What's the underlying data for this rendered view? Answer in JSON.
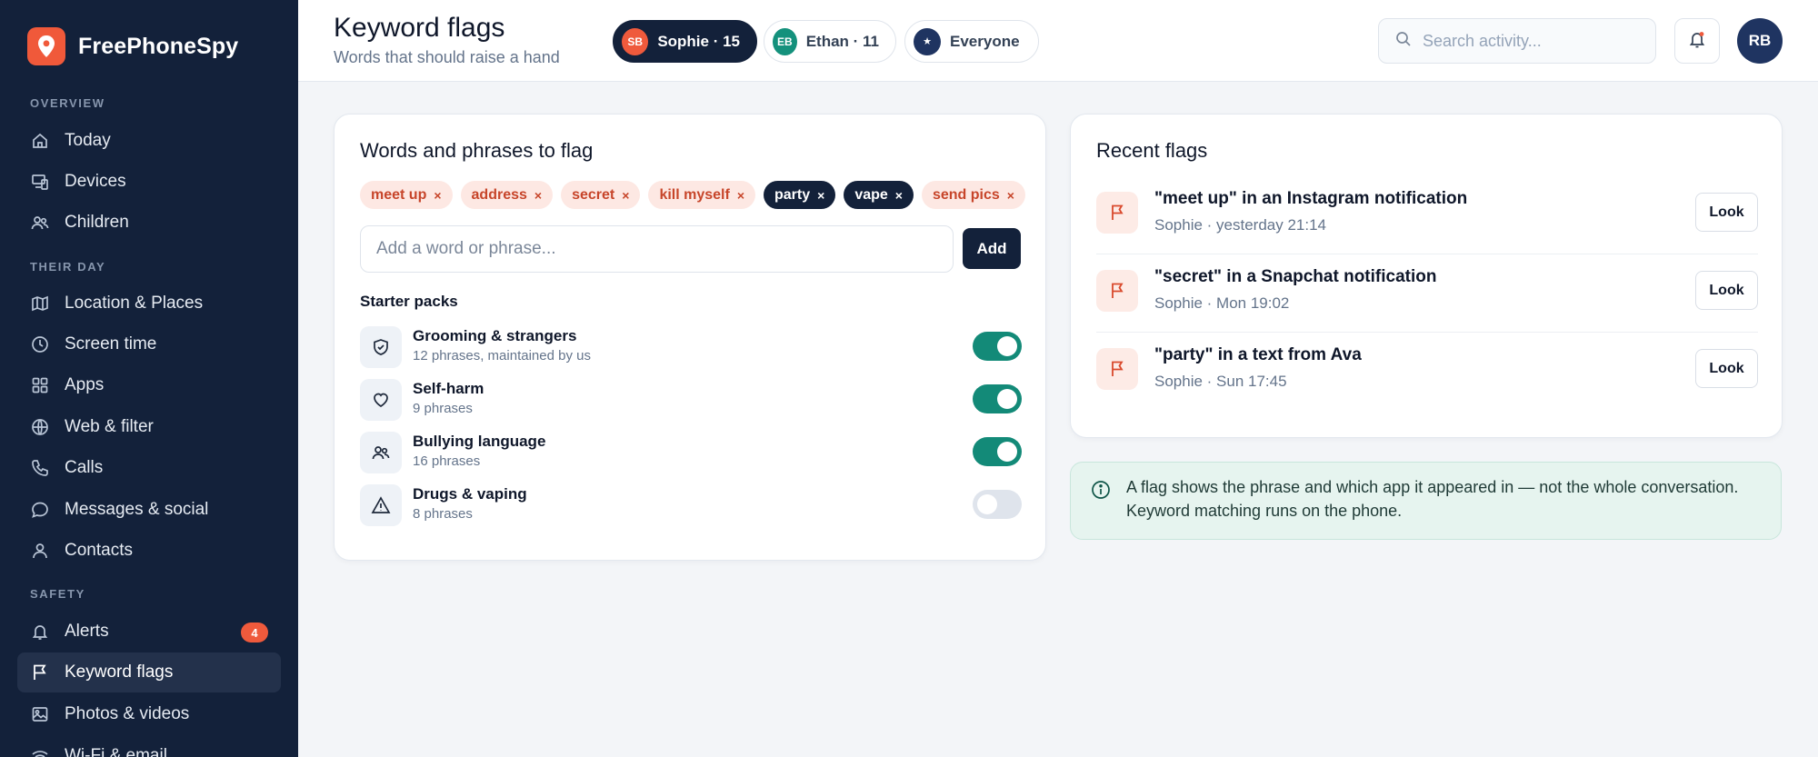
{
  "app": {
    "name": "FreePhoneSpy"
  },
  "sidebar": {
    "sections": [
      {
        "label": "OVERVIEW",
        "items": [
          {
            "label": "Today",
            "icon": "home-icon"
          },
          {
            "label": "Devices",
            "icon": "devices-icon"
          },
          {
            "label": "Children",
            "icon": "children-icon"
          }
        ]
      },
      {
        "label": "THEIR DAY",
        "items": [
          {
            "label": "Location & Places",
            "icon": "map-icon"
          },
          {
            "label": "Screen time",
            "icon": "clock-icon"
          },
          {
            "label": "Apps",
            "icon": "grid-icon"
          },
          {
            "label": "Web & filter",
            "icon": "globe-icon"
          },
          {
            "label": "Calls",
            "icon": "phone-icon"
          },
          {
            "label": "Messages & social",
            "icon": "chat-icon"
          },
          {
            "label": "Contacts",
            "icon": "person-icon"
          }
        ]
      },
      {
        "label": "SAFETY",
        "items": [
          {
            "label": "Alerts",
            "icon": "bell-icon",
            "badge": "4"
          },
          {
            "label": "Keyword flags",
            "icon": "flag-icon",
            "active": true
          },
          {
            "label": "Photos & videos",
            "icon": "image-icon"
          },
          {
            "label": "Wi-Fi & email",
            "icon": "wifi-icon"
          }
        ]
      }
    ]
  },
  "header": {
    "title": "Keyword flags",
    "subtitle": "Words that should raise a hand",
    "chips": [
      {
        "initials": "SB",
        "label": "Sophie · 15",
        "active": true,
        "color": "#ef5a3c"
      },
      {
        "initials": "EB",
        "label": "Ethan · 11",
        "active": false,
        "color": "#14917c"
      },
      {
        "initials": "★",
        "label": "Everyone",
        "active": false,
        "color": "#1f3461"
      }
    ],
    "search_placeholder": "Search activity...",
    "user_initials": "RB"
  },
  "keywords_card": {
    "title": "Words and phrases to flag",
    "tags": [
      {
        "label": "meet up",
        "style": "light"
      },
      {
        "label": "address",
        "style": "light"
      },
      {
        "label": "secret",
        "style": "light"
      },
      {
        "label": "kill myself",
        "style": "light"
      },
      {
        "label": "party",
        "style": "dark"
      },
      {
        "label": "vape",
        "style": "dark"
      },
      {
        "label": "send pics",
        "style": "light"
      }
    ],
    "remove_glyph": "×",
    "input_placeholder": "Add a word or phrase...",
    "add_label": "Add",
    "packs_label": "Starter packs",
    "packs": [
      {
        "name": "Grooming & strangers",
        "sub": "12 phrases, maintained by us",
        "icon": "shield-check-icon",
        "enabled": true
      },
      {
        "name": "Self-harm",
        "sub": "9 phrases",
        "icon": "heart-icon",
        "enabled": true
      },
      {
        "name": "Bullying language",
        "sub": "16 phrases",
        "icon": "people-icon",
        "enabled": true
      },
      {
        "name": "Drugs & vaping",
        "sub": "8 phrases",
        "icon": "warning-icon",
        "enabled": false
      }
    ]
  },
  "recent_card": {
    "title": "Recent flags",
    "flags": [
      {
        "title": "\"meet up\" in an Instagram notification",
        "meta": "Sophie · yesterday 21:14",
        "action": "Look"
      },
      {
        "title": "\"secret\" in a Snapchat notification",
        "meta": "Sophie · Mon 19:02",
        "action": "Look"
      },
      {
        "title": "\"party\" in a text from Ava",
        "meta": "Sophie · Sun 17:45",
        "action": "Look"
      }
    ]
  },
  "info": {
    "text": "A flag shows the phrase and which app it appeared in — not the whole conversation. Keyword matching runs on the phone."
  },
  "colors": {
    "sidebar": "#13213a",
    "accent": "#ef5a3c",
    "toggle_on": "#138a78"
  }
}
